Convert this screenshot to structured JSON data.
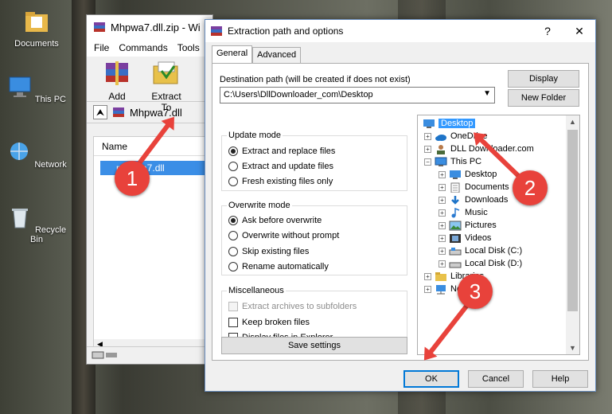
{
  "desktop": {
    "icons": [
      {
        "label": "Documents",
        "icon": "folder-documents-icon"
      },
      {
        "label": "This PC",
        "icon": "computer-icon"
      },
      {
        "label": "Network",
        "icon": "network-icon"
      },
      {
        "label": "Recycle Bin",
        "icon": "recycle-bin-icon"
      }
    ]
  },
  "winrar": {
    "title": "Mhpwa7.dll.zip - Wi",
    "menu": [
      "File",
      "Commands",
      "Tools"
    ],
    "tools": [
      {
        "label": "Add"
      },
      {
        "label": "Extract To"
      }
    ],
    "path": "Mhpwa7.dll",
    "column_name": "Name",
    "file": "mhpwa7.dll"
  },
  "dialog": {
    "title": "Extraction path and options",
    "help": "?",
    "close": "✕",
    "tabs": [
      "General",
      "Advanced"
    ],
    "dest_label": "Destination path (will be created if does not exist)",
    "dest_value": "C:\\Users\\DllDownloader_com\\Desktop",
    "display_button": "Display",
    "new_folder_button": "New Folder",
    "update_mode": {
      "title": "Update mode",
      "options": [
        "Extract and replace files",
        "Extract and update files",
        "Fresh existing files only"
      ],
      "selected": 0
    },
    "overwrite_mode": {
      "title": "Overwrite mode",
      "options": [
        "Ask before overwrite",
        "Overwrite without prompt",
        "Skip existing files",
        "Rename automatically"
      ],
      "selected": 0
    },
    "misc": {
      "title": "Miscellaneous",
      "options": [
        {
          "label": "Extract archives to subfolders",
          "checked": false,
          "disabled": true
        },
        {
          "label": "Keep broken files",
          "checked": false,
          "disabled": false
        },
        {
          "label": "Display files in Explorer",
          "checked": false,
          "disabled": false
        }
      ]
    },
    "save_settings_button": "Save settings",
    "tree": [
      {
        "label": "Desktop",
        "level": 0,
        "selected": true,
        "icon": "desktop-icon"
      },
      {
        "label": "OneDrive",
        "level": 1,
        "icon": "onedrive-icon"
      },
      {
        "label": "DLL Downloader.com",
        "level": 1,
        "icon": "user-icon"
      },
      {
        "label": "This PC",
        "level": 1,
        "icon": "computer-icon"
      },
      {
        "label": "Desktop",
        "level": 2,
        "icon": "desktop-icon"
      },
      {
        "label": "Documents",
        "level": 2,
        "icon": "documents-icon"
      },
      {
        "label": "Downloads",
        "level": 2,
        "icon": "downloads-icon"
      },
      {
        "label": "Music",
        "level": 2,
        "icon": "music-icon"
      },
      {
        "label": "Pictures",
        "level": 2,
        "icon": "pictures-icon"
      },
      {
        "label": "Videos",
        "level": 2,
        "icon": "videos-icon"
      },
      {
        "label": "Local Disk (C:)",
        "level": 2,
        "icon": "drive-icon"
      },
      {
        "label": "Local Disk (D:)",
        "level": 2,
        "icon": "drive-icon"
      },
      {
        "label": "Libraries",
        "level": 1,
        "icon": "libraries-icon"
      },
      {
        "label": "Network",
        "level": 1,
        "icon": "network-icon"
      }
    ],
    "ok_button": "OK",
    "cancel_button": "Cancel",
    "help_button": "Help"
  },
  "annotations": [
    {
      "number": "1"
    },
    {
      "number": "2"
    },
    {
      "number": "3"
    }
  ],
  "colors": {
    "accent": "#0078d7",
    "selection": "#3399ff",
    "annotation": "#e8423b"
  }
}
